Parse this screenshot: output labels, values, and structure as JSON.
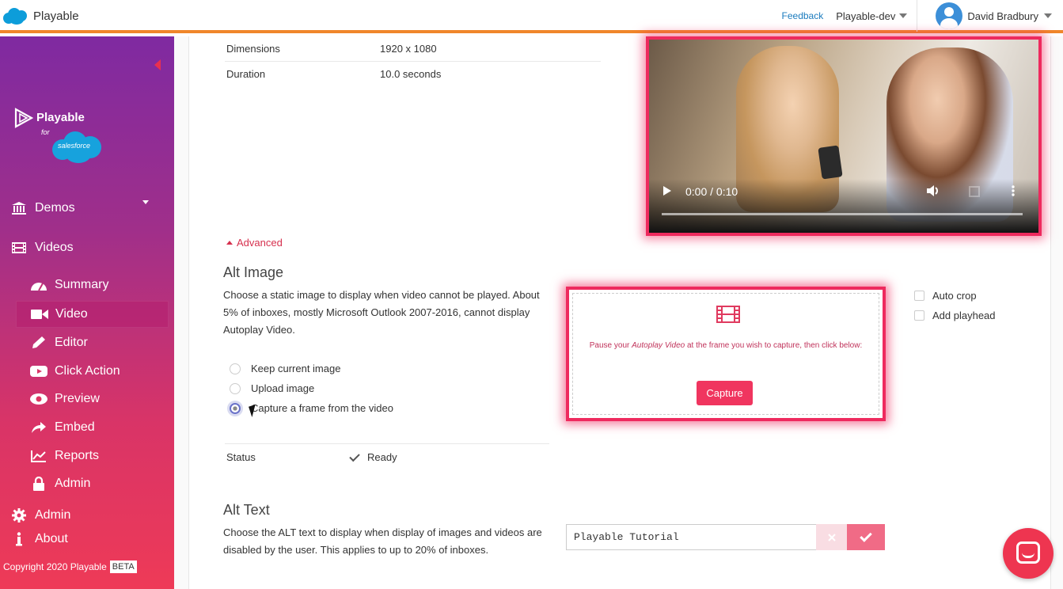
{
  "topbar": {
    "app_name": "Playable",
    "feedback": "Feedback",
    "org": "Playable-dev",
    "user": "David Bradbury"
  },
  "sidebar": {
    "logo_word": "Playable",
    "logo_for": "for",
    "logo_salesforce": "salesforce",
    "items": [
      {
        "label": "Demos",
        "icon": "bank-icon"
      },
      {
        "label": "Videos",
        "icon": "film-icon"
      }
    ],
    "sub_items": [
      {
        "label": "Summary",
        "icon": "dashboard-icon"
      },
      {
        "label": "Video",
        "icon": "video-camera-icon"
      },
      {
        "label": "Editor",
        "icon": "pencil-icon"
      },
      {
        "label": "Click Action",
        "icon": "youtube-play-icon"
      },
      {
        "label": "Preview",
        "icon": "eye-icon"
      },
      {
        "label": "Embed",
        "icon": "share-icon"
      },
      {
        "label": "Reports",
        "icon": "line-chart-icon"
      },
      {
        "label": "Admin",
        "icon": "lock-icon"
      }
    ],
    "bottom_items": [
      {
        "label": "Admin",
        "icon": "gear-icon"
      },
      {
        "label": "About",
        "icon": "info-icon"
      }
    ],
    "footer": "Copyright 2020 Playable",
    "beta": "BETA"
  },
  "meta": {
    "rows": [
      {
        "key": "Dimensions",
        "value": "1920 x 1080"
      },
      {
        "key": "Duration",
        "value": "10.0 seconds"
      }
    ]
  },
  "video": {
    "time": "0:00 / 0:10",
    "progress": 0
  },
  "advanced_label": "Advanced",
  "alt_image": {
    "heading": "Alt Image",
    "description": "Choose a static image to display when video cannot be played. About 5% of inboxes, mostly Microsoft Outlook 2007-2016, cannot display Autoplay Video.",
    "options": [
      "Keep current image",
      "Upload image",
      "Capture a frame from the video"
    ],
    "selected": "Capture a frame from the video",
    "status_label": "Status",
    "status_value": "Ready",
    "capture_text_1": "Pause your",
    "capture_text_em": "Autoplay Video",
    "capture_text_2": "at the frame you wish to capture, then click below:",
    "capture_button": "Capture",
    "auto_crop": "Auto crop",
    "add_playhead": "Add playhead"
  },
  "alt_text": {
    "heading": "Alt Text",
    "description": "Choose the ALT text to display when display of images and videos are disabled by the user. This applies to up to 20% of inboxes.",
    "value": "Playable Tutorial"
  },
  "colors": {
    "accent": "#ee2a5e",
    "topbar_border": "#f0862a",
    "link": "#1b7bbe"
  }
}
